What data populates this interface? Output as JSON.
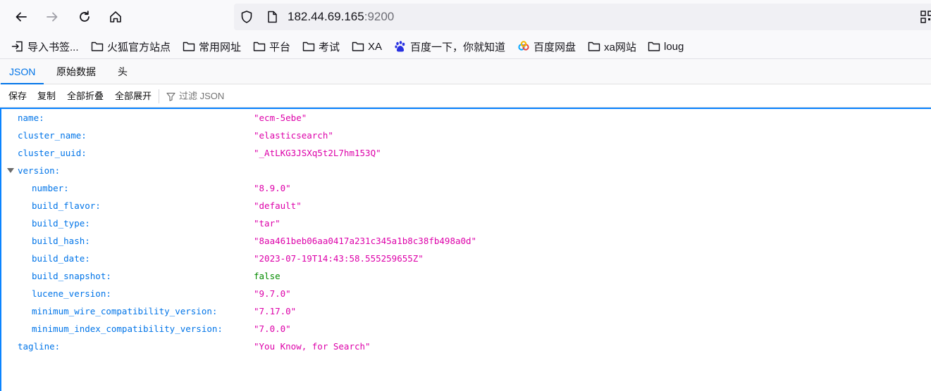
{
  "browser": {
    "url_host": "182.44.69.165",
    "url_port": ":9200"
  },
  "bookmarks": [
    {
      "label": "导入书签...",
      "icon": "import-icon"
    },
    {
      "label": "火狐官方站点",
      "icon": "folder-icon"
    },
    {
      "label": "常用网址",
      "icon": "folder-icon"
    },
    {
      "label": "平台",
      "icon": "folder-icon"
    },
    {
      "label": "考试",
      "icon": "folder-icon"
    },
    {
      "label": "XA",
      "icon": "folder-icon"
    },
    {
      "label": "百度一下，你就知道",
      "icon": "baidu-icon"
    },
    {
      "label": "百度网盘",
      "icon": "baidu-netdisk-icon"
    },
    {
      "label": "xa网站",
      "icon": "folder-icon"
    },
    {
      "label": "loug",
      "icon": "folder-icon"
    }
  ],
  "viewer": {
    "tabs": [
      "JSON",
      "原始数据",
      "头"
    ],
    "toolbar": {
      "save": "保存",
      "copy": "复制",
      "collapse_all": "全部折叠",
      "expand_all": "全部展开",
      "filter_placeholder": "过滤 JSON"
    }
  },
  "json_rows": [
    {
      "key": "name:",
      "value": "\"ecm-5ebe\"",
      "type": "str",
      "level": 0
    },
    {
      "key": "cluster_name:",
      "value": "\"elasticsearch\"",
      "type": "str",
      "level": 0
    },
    {
      "key": "cluster_uuid:",
      "value": "\"_AtLKG3JSXq5t2L7hm153Q\"",
      "type": "str",
      "level": 0
    },
    {
      "key": "version:",
      "value": "",
      "type": "object",
      "level": 0
    },
    {
      "key": "number:",
      "value": "\"8.9.0\"",
      "type": "str",
      "level": 1
    },
    {
      "key": "build_flavor:",
      "value": "\"default\"",
      "type": "str",
      "level": 1
    },
    {
      "key": "build_type:",
      "value": "\"tar\"",
      "type": "str",
      "level": 1
    },
    {
      "key": "build_hash:",
      "value": "\"8aa461beb06aa0417a231c345a1b8c38fb498a0d\"",
      "type": "str",
      "level": 1
    },
    {
      "key": "build_date:",
      "value": "\"2023-07-19T14:43:58.555259655Z\"",
      "type": "str",
      "level": 1
    },
    {
      "key": "build_snapshot:",
      "value": "false",
      "type": "bool",
      "level": 1
    },
    {
      "key": "lucene_version:",
      "value": "\"9.7.0\"",
      "type": "str",
      "level": 1
    },
    {
      "key": "minimum_wire_compatibility_version:",
      "value": "\"7.17.0\"",
      "type": "str",
      "level": 1
    },
    {
      "key": "minimum_index_compatibility_version:",
      "value": "\"7.0.0\"",
      "type": "str",
      "level": 1
    },
    {
      "key": "tagline:",
      "value": "\"You Know, for Search\"",
      "type": "str",
      "level": 0
    }
  ]
}
